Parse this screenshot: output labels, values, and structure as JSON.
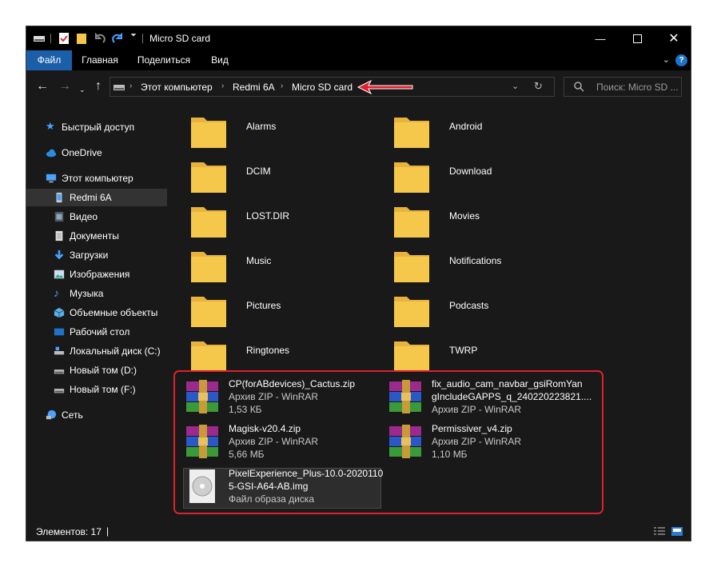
{
  "window": {
    "title": "Micro SD card"
  },
  "ribbon": {
    "tabs": [
      "Файл",
      "Главная",
      "Поделиться",
      "Вид"
    ]
  },
  "address": {
    "crumbs": [
      "Этот компьютер",
      "Redmi 6A",
      "Micro SD card"
    ],
    "search_placeholder": "Поиск: Micro SD ..."
  },
  "sidebar": {
    "items": [
      {
        "label": "Быстрый доступ",
        "icon": "star-icon"
      },
      {
        "label": "OneDrive",
        "icon": "cloud-icon"
      },
      {
        "label": "Этот компьютер",
        "icon": "computer-icon"
      },
      {
        "label": "Redmi 6A",
        "icon": "phone-icon"
      },
      {
        "label": "Видео",
        "icon": "video-icon"
      },
      {
        "label": "Документы",
        "icon": "documents-icon"
      },
      {
        "label": "Загрузки",
        "icon": "download-icon"
      },
      {
        "label": "Изображения",
        "icon": "pictures-icon"
      },
      {
        "label": "Музыка",
        "icon": "music-icon"
      },
      {
        "label": "Объемные объекты",
        "icon": "3d-objects-icon"
      },
      {
        "label": "Рабочий стол",
        "icon": "desktop-icon"
      },
      {
        "label": "Локальный диск (C:)",
        "icon": "drive-c-icon"
      },
      {
        "label": "Новый том (D:)",
        "icon": "drive-icon"
      },
      {
        "label": "Новый том (F:)",
        "icon": "drive-icon"
      },
      {
        "label": "Сеть",
        "icon": "network-icon"
      }
    ]
  },
  "folders": [
    "Alarms",
    "Android",
    "DCIM",
    "Download",
    "LOST.DIR",
    "Movies",
    "Music",
    "Notifications",
    "Pictures",
    "Podcasts",
    "Ringtones",
    "TWRP"
  ],
  "files": [
    {
      "name": "CP(forABdevices)_Cactus.zip",
      "name2": "",
      "type": "Архив ZIP - WinRAR",
      "size": "1,53 КБ"
    },
    {
      "name": "fix_audio_cam_navbar_gsiRomYan",
      "name2": "gIncludeGAPPS_q_240220223821....",
      "type": "Архив ZIP - WinRAR",
      "size": ""
    },
    {
      "name": "Magisk-v20.4.zip",
      "name2": "",
      "type": "Архив ZIP - WinRAR",
      "size": "5,66 МБ"
    },
    {
      "name": "Permissiver_v4.zip",
      "name2": "",
      "type": "Архив ZIP - WinRAR",
      "size": "1,10 МБ"
    },
    {
      "name": "PixelExperience_Plus-10.0-2020110",
      "name2": "5-GSI-A64-AB.img",
      "type": "Файл образа диска",
      "size": ""
    }
  ],
  "status": {
    "text": "Элементов: 17"
  },
  "colors": {
    "accent": "#1a5fa8",
    "highlight": "#e0202e",
    "folder": "#f5c84c"
  }
}
